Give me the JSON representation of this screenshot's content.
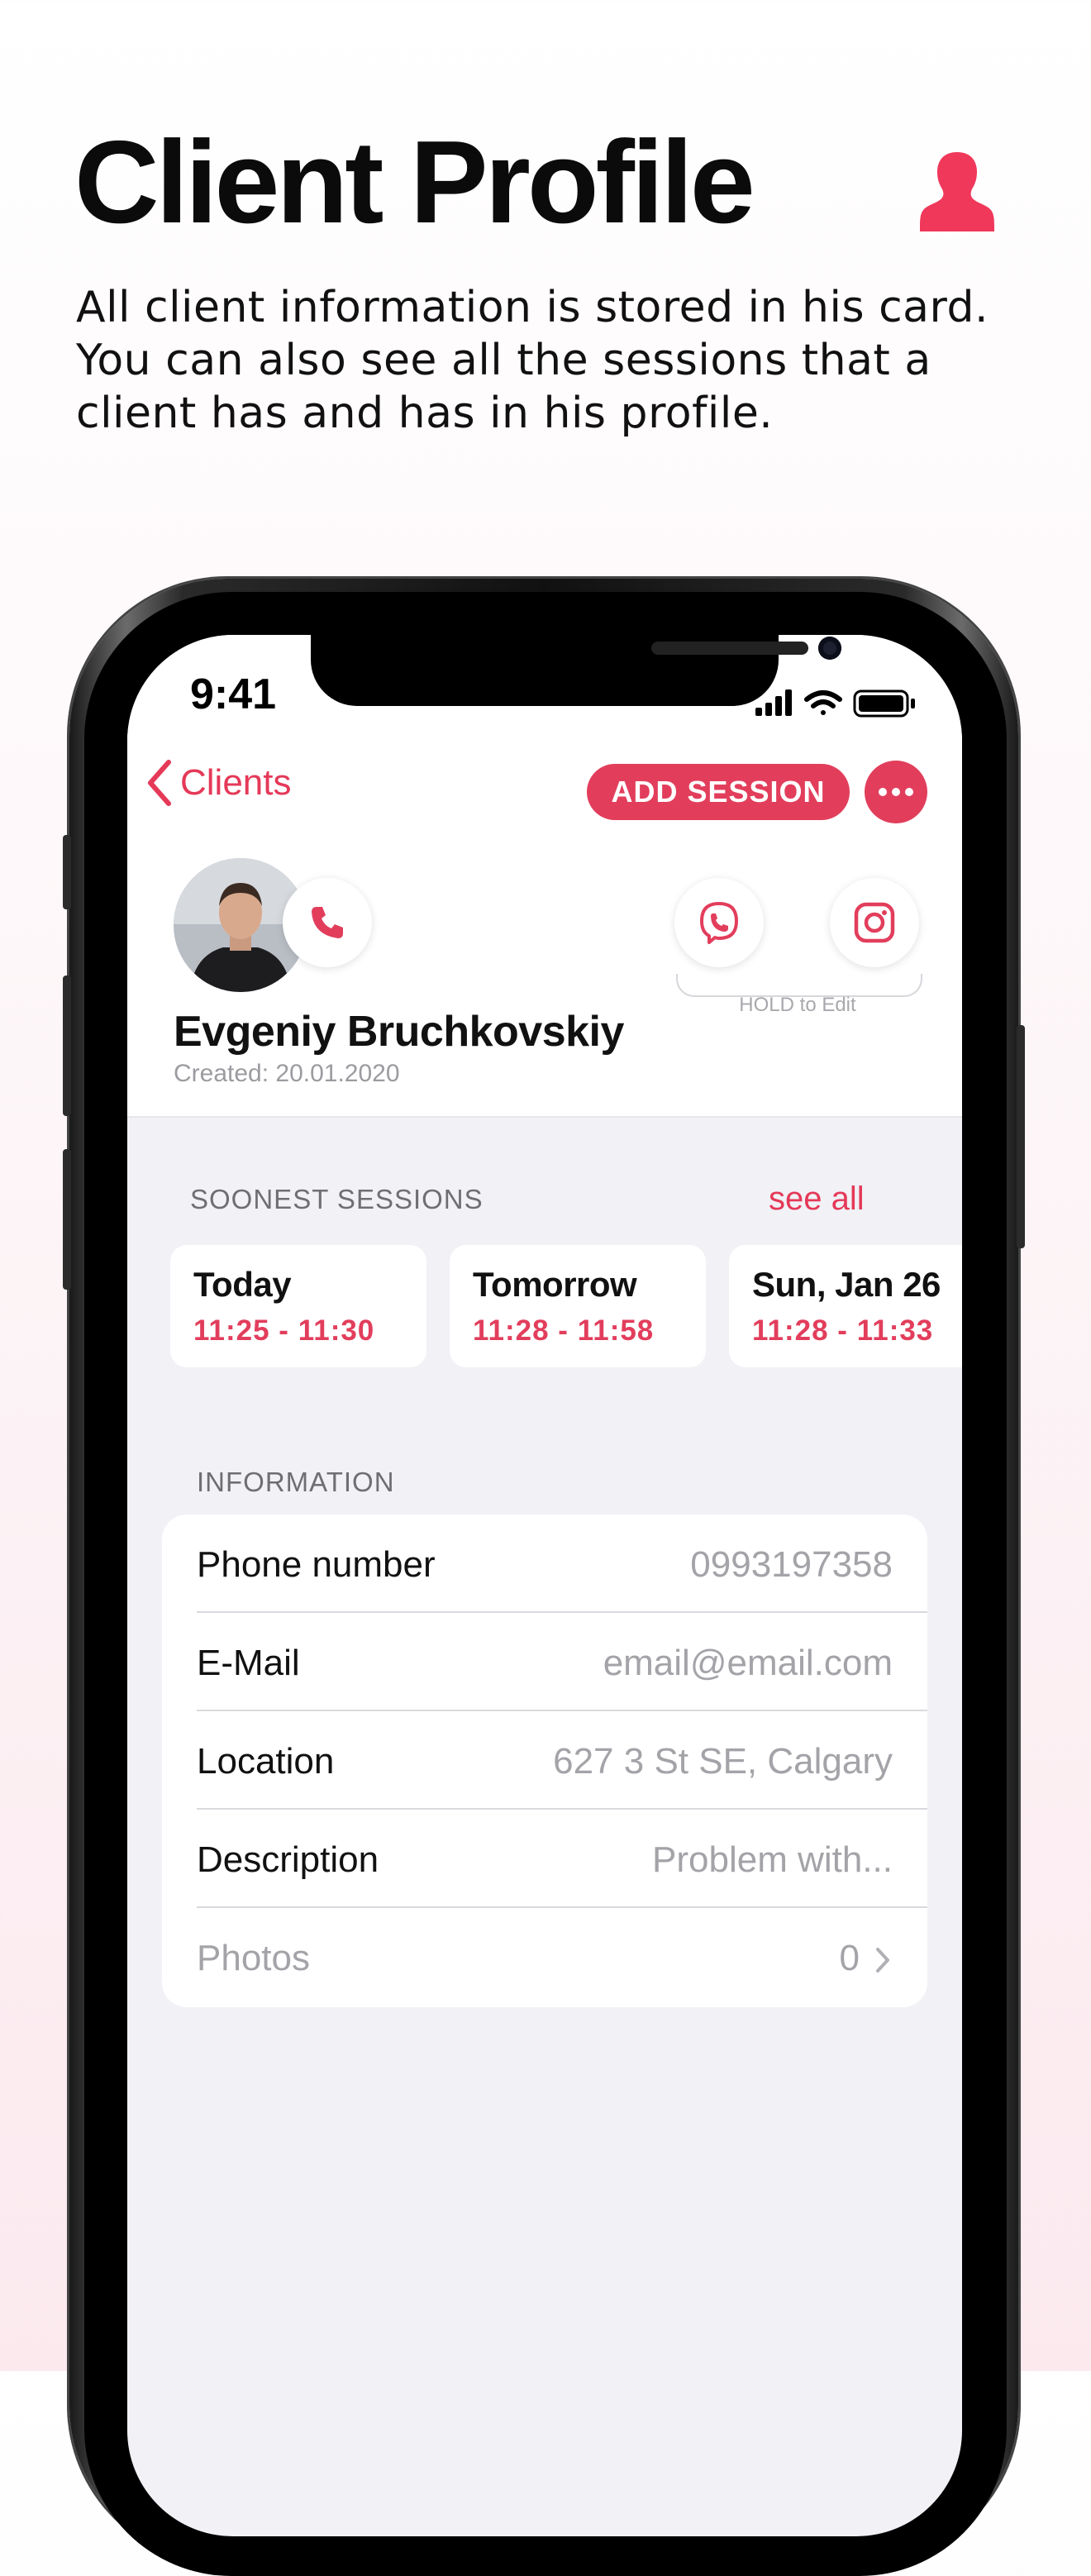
{
  "header": {
    "title": "Client Profile",
    "subtitle": "All client information is stored in his card. You can also see all the sessions that a client has and has in his profile.",
    "icon": "person-silhouette-icon",
    "accent_color": "#f0385a"
  },
  "status_bar": {
    "time": "9:41"
  },
  "nav": {
    "back_label": "Clients",
    "add_session_label": "ADD SESSION",
    "more_icon": "ellipsis-icon"
  },
  "client": {
    "name": "Evgeniy Bruchkovskiy",
    "created": "Created: 20.01.2020",
    "contact_actions": [
      "phone-icon",
      "viber-icon",
      "instagram-icon"
    ],
    "hold_hint": "HOLD to Edit"
  },
  "sessions": {
    "title": "SOONEST SESSIONS",
    "see_all": "see all",
    "items": [
      {
        "day": "Today",
        "hours": "11:25 - 11:30"
      },
      {
        "day": "Tomorrow",
        "hours": "11:28 - 11:58"
      },
      {
        "day": "Sun, Jan 26",
        "hours": "11:28 - 11:33"
      }
    ]
  },
  "information": {
    "title": "INFORMATION",
    "rows": [
      {
        "label": "Phone number",
        "value": "0993197358"
      },
      {
        "label": "E-Mail",
        "value": "email@email.com"
      },
      {
        "label": "Location",
        "value": "627 3 St SE, Calgary"
      },
      {
        "label": "Description",
        "value": "Problem with..."
      },
      {
        "label": "Photos",
        "value": "0"
      }
    ]
  }
}
